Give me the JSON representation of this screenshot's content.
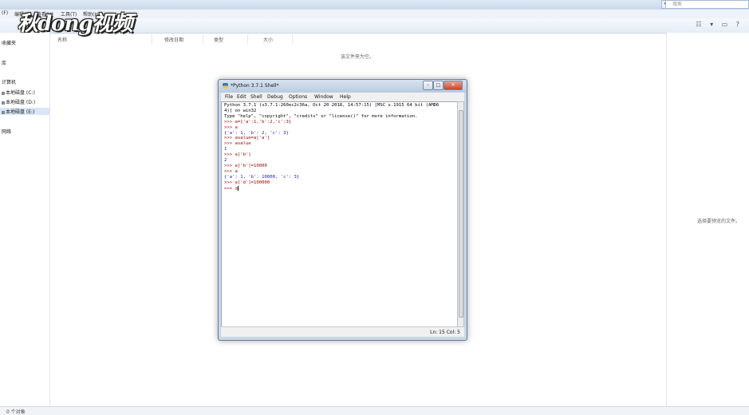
{
  "explorer": {
    "menu": [
      "(F)",
      "编辑(E)",
      "查看(V)",
      "工具(T)",
      "帮助(H)"
    ],
    "search_placeholder": "搜索",
    "watermark": "秋dong视频",
    "nav": {
      "favorites": "收藏夹",
      "library": "库",
      "computer": "计算机",
      "drives": [
        "本地磁盘 (C:)",
        "本地磁盘 (D:)",
        "本地磁盘 (E:)"
      ],
      "network": "网络"
    },
    "columns": [
      "名称",
      "修改日期",
      "类型",
      "大小"
    ],
    "empty_message": "该文件夹为空。",
    "preview_message": "选择要预览的文件。",
    "status": "0 个对象"
  },
  "idle": {
    "title": "*Python 3.7.1 Shell*",
    "menu": [
      "File",
      "Edit",
      "Shell",
      "Debug",
      "Options",
      "Window",
      "Help"
    ],
    "lines": [
      {
        "cls": "",
        "text": "Python 3.7.1 (v3.7.1:260ec2c36a, Oct 20 2018, 14:57:15) [MSC v.1915 64 bit (AMD6"
      },
      {
        "cls": "",
        "text": "4)] on win32"
      },
      {
        "cls": "",
        "text": "Type \"help\", \"copyright\", \"credits\" or \"license()\" for more information."
      },
      {
        "cls": "prompt",
        "text": ">>> a={'a':1,'b':2,'c':3}"
      },
      {
        "cls": "prompt",
        "text": ">>> a"
      },
      {
        "cls": "outp",
        "text": "{'a': 1, 'b': 2, 'c': 3}"
      },
      {
        "cls": "prompt",
        "text": ">>> avalue=a['a']"
      },
      {
        "cls": "prompt",
        "text": ">>> avalue"
      },
      {
        "cls": "outp",
        "text": "1"
      },
      {
        "cls": "prompt",
        "text": ">>> a['b']"
      },
      {
        "cls": "outp",
        "text": "2"
      },
      {
        "cls": "prompt",
        "text": ">>> a['b']=10000"
      },
      {
        "cls": "prompt",
        "text": ">>> a"
      },
      {
        "cls": "outp",
        "text": "{'a': 1, 'b': 10000, 'c': 3}"
      },
      {
        "cls": "prompt",
        "text": ">>> a['d']=100000"
      },
      {
        "cls": "prompt",
        "text": ">>> a"
      }
    ],
    "status": "Ln: 15   Col: 5",
    "buttons": {
      "minimize": "–",
      "maximize": "□",
      "close": "✕"
    }
  }
}
